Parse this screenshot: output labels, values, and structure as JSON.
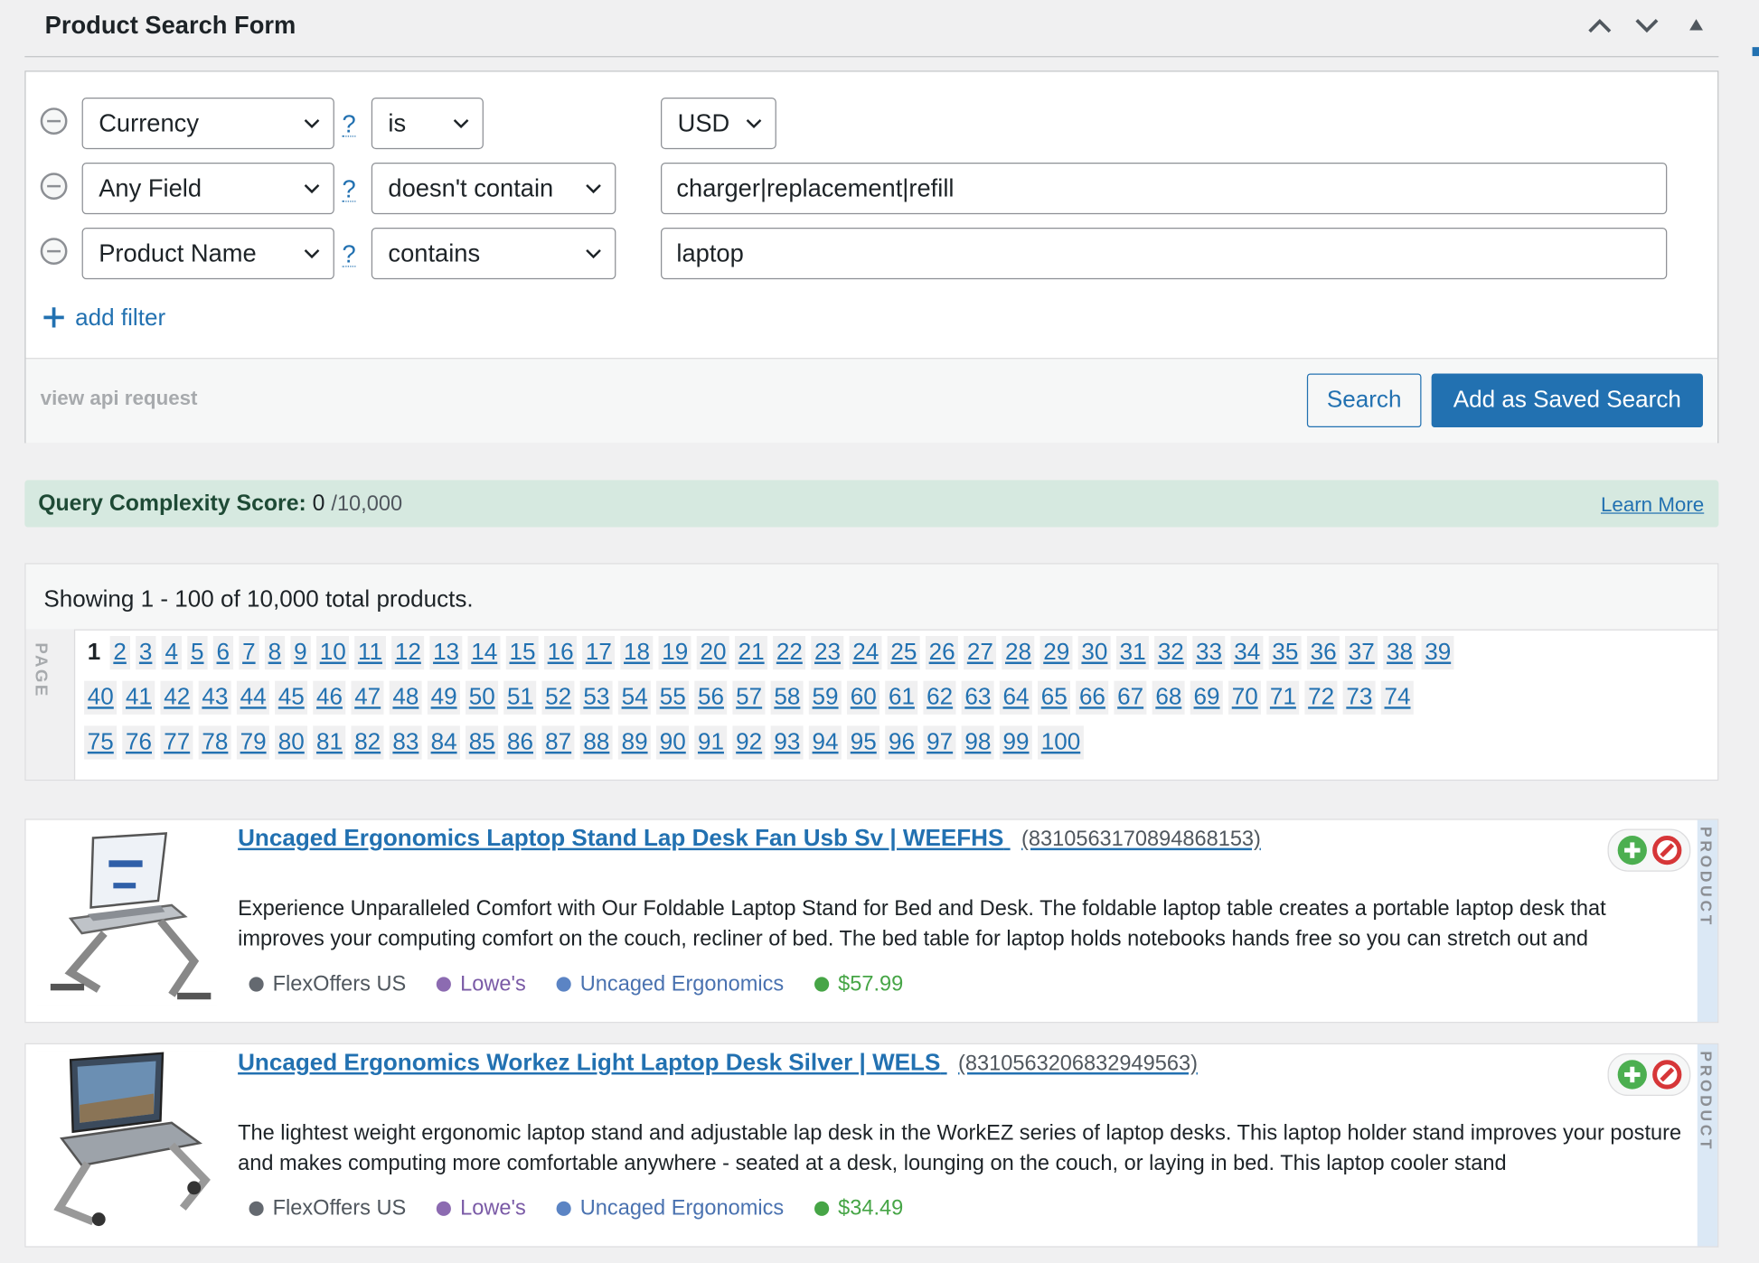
{
  "panel": {
    "title": "Product Search Form"
  },
  "filters": [
    {
      "field": "Currency",
      "help": "?",
      "operator": "is",
      "value": "USD",
      "value_type": "select"
    },
    {
      "field": "Any Field",
      "help": "?",
      "operator": "doesn't contain",
      "value": "charger|replacement|refill",
      "value_type": "text"
    },
    {
      "field": "Product Name",
      "help": "?",
      "operator": "contains",
      "value": "laptop",
      "value_type": "text"
    }
  ],
  "form": {
    "add_filter_label": "add filter",
    "view_api_label": "view api request",
    "search_label": "Search",
    "save_label": "Add as Saved Search"
  },
  "score": {
    "label": "Query Complexity Score:",
    "value": "0",
    "max": "/10,000",
    "learn_more": "Learn More"
  },
  "results": {
    "showing_text": "Showing 1 - 100 of 10,000 total products.",
    "page_label": "PAGE",
    "current_page": 1,
    "total_pages": 100
  },
  "products": [
    {
      "title": "Uncaged Ergonomics Laptop Stand Lap Desk Fan Usb Sv | WEEFHS",
      "id": "(8310563170894868153)",
      "description": "Experience Unparalleled Comfort with Our Foldable Laptop Stand for Bed and Desk. The foldable laptop table creates a portable laptop desk that improves your computing comfort on the couch, recliner of bed. The bed table for laptop holds notebooks hands free so you can stretch out and",
      "network": "FlexOffers US",
      "merchant": "Lowe's",
      "brand": "Uncaged Ergonomics",
      "price": "$57.99",
      "side_label": "PRODUCT"
    },
    {
      "title": "Uncaged Ergonomics Workez Light Laptop Desk Silver | WELS",
      "id": "(8310563206832949563)",
      "description": "The lightest weight ergonomic laptop stand and adjustable lap desk in the WorkEZ series of laptop desks. This laptop holder stand improves your posture and makes computing more comfortable anywhere - seated at a desk, lounging on the couch, or laying in bed. This laptop cooler stand",
      "network": "FlexOffers US",
      "merchant": "Lowe's",
      "brand": "Uncaged Ergonomics",
      "price": "$34.49",
      "side_label": "PRODUCT"
    }
  ],
  "colors": {
    "link": "#2271b1",
    "network_dot": "#646970",
    "merchant_dot": "#8c6bb1",
    "brand_dot": "#5b84c4",
    "price": "#46a546",
    "score_bg": "#d6e9e0"
  },
  "icons": [
    "chevron-up-icon",
    "chevron-down-icon",
    "triangle-up-icon",
    "minus-circle-icon",
    "plus-icon",
    "add-circle-icon",
    "block-icon"
  ]
}
